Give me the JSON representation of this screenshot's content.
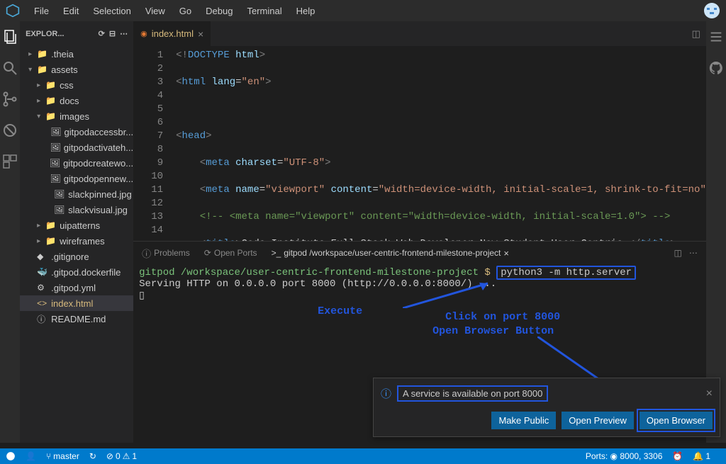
{
  "menubar": {
    "items": [
      "File",
      "Edit",
      "Selection",
      "View",
      "Go",
      "Debug",
      "Terminal",
      "Help"
    ]
  },
  "explorer": {
    "title": "EXPLOR...",
    "tree": [
      {
        "depth": 0,
        "chev": "▸",
        "icon": "📁",
        "label": ".theia"
      },
      {
        "depth": 0,
        "chev": "▾",
        "icon": "📁",
        "label": "assets"
      },
      {
        "depth": 1,
        "chev": "▸",
        "icon": "📁",
        "label": "css"
      },
      {
        "depth": 1,
        "chev": "▸",
        "icon": "📁",
        "label": "docs"
      },
      {
        "depth": 1,
        "chev": "▾",
        "icon": "📁",
        "label": "images"
      },
      {
        "depth": 2,
        "chev": "",
        "icon": "🖼",
        "label": "gitpodaccessbr..."
      },
      {
        "depth": 2,
        "chev": "",
        "icon": "🖼",
        "label": "gitpodactivateh..."
      },
      {
        "depth": 2,
        "chev": "",
        "icon": "🖼",
        "label": "gitpodcreatewo..."
      },
      {
        "depth": 2,
        "chev": "",
        "icon": "🖼",
        "label": "gitpodopennew..."
      },
      {
        "depth": 2,
        "chev": "",
        "icon": "🖼",
        "label": "slackpinned.jpg"
      },
      {
        "depth": 2,
        "chev": "",
        "icon": "🖼",
        "label": "slackvisual.jpg"
      },
      {
        "depth": 1,
        "chev": "▸",
        "icon": "📁",
        "label": "uipatterns"
      },
      {
        "depth": 1,
        "chev": "▸",
        "icon": "📁",
        "label": "wireframes"
      },
      {
        "depth": 0,
        "chev": "",
        "icon": "◆",
        "label": ".gitignore"
      },
      {
        "depth": 0,
        "chev": "",
        "icon": "🐳",
        "label": ".gitpod.dockerfile"
      },
      {
        "depth": 0,
        "chev": "",
        "icon": "⚙",
        "label": ".gitpod.yml"
      },
      {
        "depth": 0,
        "chev": "",
        "icon": "<>",
        "label": "index.html",
        "modified": true,
        "selected": true
      },
      {
        "depth": 0,
        "chev": "",
        "icon": "ⓘ",
        "label": "README.md"
      }
    ]
  },
  "tabs": {
    "active": "index.html"
  },
  "code_lines": [
    "1",
    "2",
    "3",
    "4",
    "5",
    "6",
    "7",
    "8",
    "9",
    "10",
    "11",
    "12",
    "13",
    "14"
  ],
  "panel": {
    "tabs": {
      "problems": "Problems",
      "openports": "Open Ports",
      "terminal_title": "gitpod /workspace/user-centric-frontend-milestone-project"
    },
    "prompt_path": "gitpod /workspace/user-centric-frontend-milestone-project",
    "prompt_char": "$",
    "command": "python3 -m http.server",
    "output": "Serving HTTP on 0.0.0.0 port 8000 (http://0.0.0.0:8000/) ..."
  },
  "annotations": {
    "execute": "Execute",
    "click_port_1": "Click on port 8000",
    "click_port_2": "Open Browser Button"
  },
  "notification": {
    "message": "A service is available on port 8000",
    "make_public": "Make Public",
    "open_preview": "Open Preview",
    "open_browser": "Open Browser"
  },
  "statusbar": {
    "branch": "master",
    "sync": "↻",
    "errors": "0",
    "warnings": "1",
    "ports": "Ports: ◉ 8000, 3306",
    "notif": "1"
  }
}
